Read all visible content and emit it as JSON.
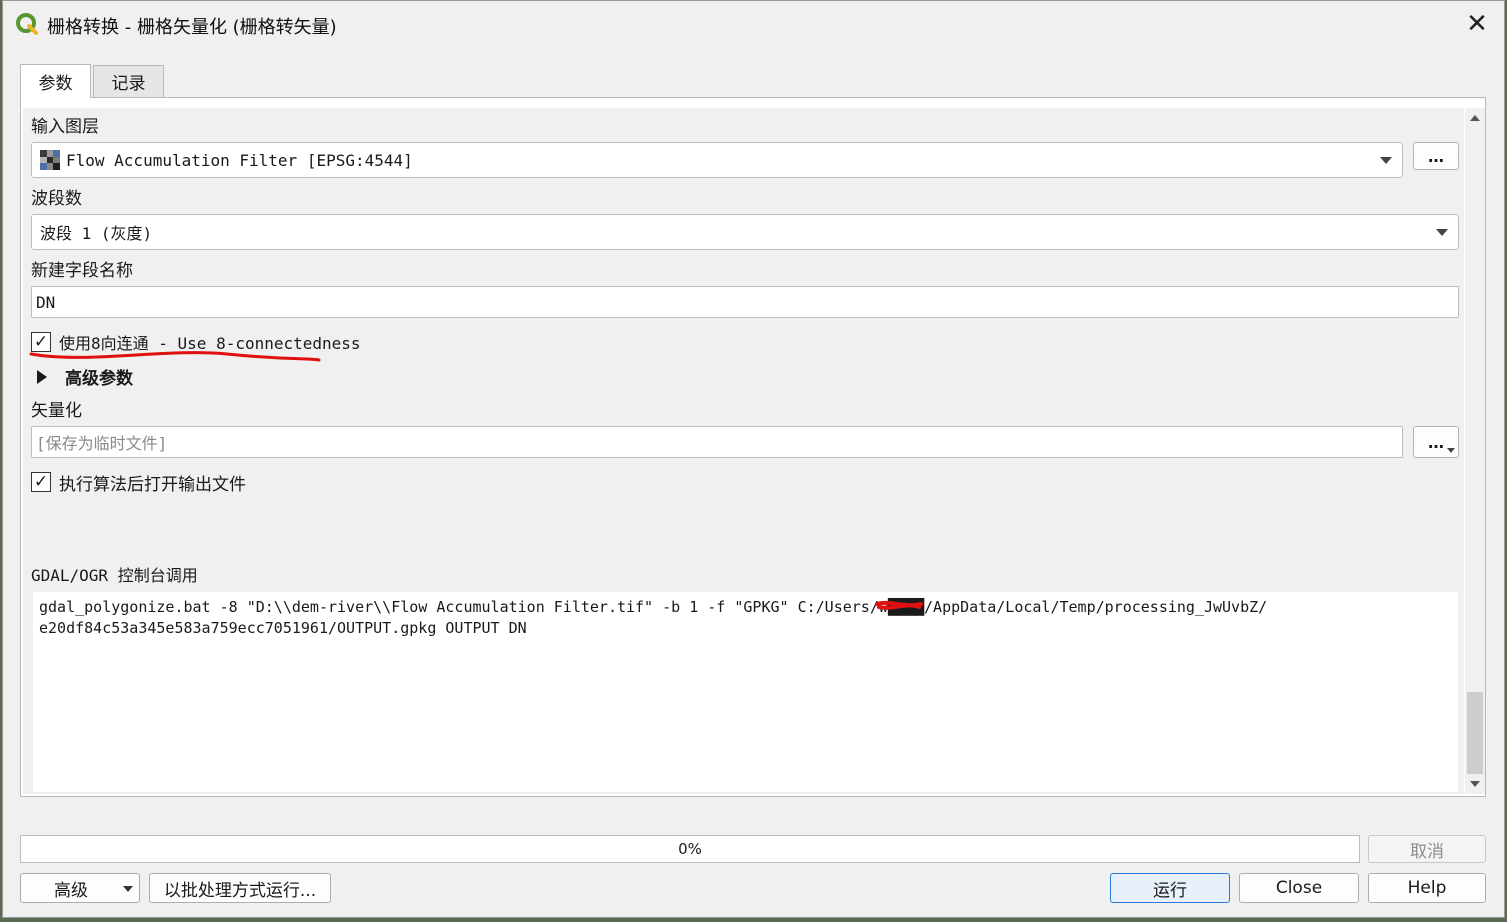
{
  "window": {
    "title": "栅格转换 - 栅格矢量化 (栅格转矢量)"
  },
  "tabs": [
    {
      "label": "参数",
      "active": true
    },
    {
      "label": "记录",
      "active": false
    }
  ],
  "params": {
    "input_layer_label": "输入图层",
    "input_layer_value": "Flow Accumulation Filter [EPSG:4544]",
    "band_label": "波段数",
    "band_value": "波段 1 (灰度)",
    "field_label": "新建字段名称",
    "field_value": "DN",
    "eight_conn_label": "使用8向连通 - Use 8-connectedness",
    "eight_conn_checked": true,
    "advanced_label": "高级参数",
    "vector_label": "矢量化",
    "vector_placeholder": "[保存为临时文件]",
    "open_after_label": "执行算法后打开输出文件",
    "open_after_checked": true,
    "dots_label": "…",
    "console_label": "GDAL/OGR 控制台调用",
    "console_line1": "gdal_polygonize.bat -8 \"D:\\\\dem-river\\\\Flow Accumulation Filter.tif\" -b 1 -f \"GPKG\" C:/Users/w████/AppData/Local/Temp/processing_JwUvbZ/",
    "console_line2": "e20df84c53a345e583a759ecc7051961/OUTPUT.gpkg OUTPUT DN"
  },
  "progress": {
    "text": "0%",
    "value": 0
  },
  "buttons": {
    "cancel": "取消",
    "advanced": "高级",
    "batch": "以批处理方式运行...",
    "run": "运行",
    "close": "Close",
    "help": "Help"
  },
  "colors": {
    "annotation": "#e01010",
    "qgis_green": "#589632",
    "default_button_border": "#2a7bd4"
  },
  "icons": [
    "qgis-logo-icon",
    "close-icon",
    "raster-layer-icon",
    "chevron-down-icon",
    "expand-triangle-icon",
    "scroll-up-icon",
    "scroll-down-icon"
  ]
}
